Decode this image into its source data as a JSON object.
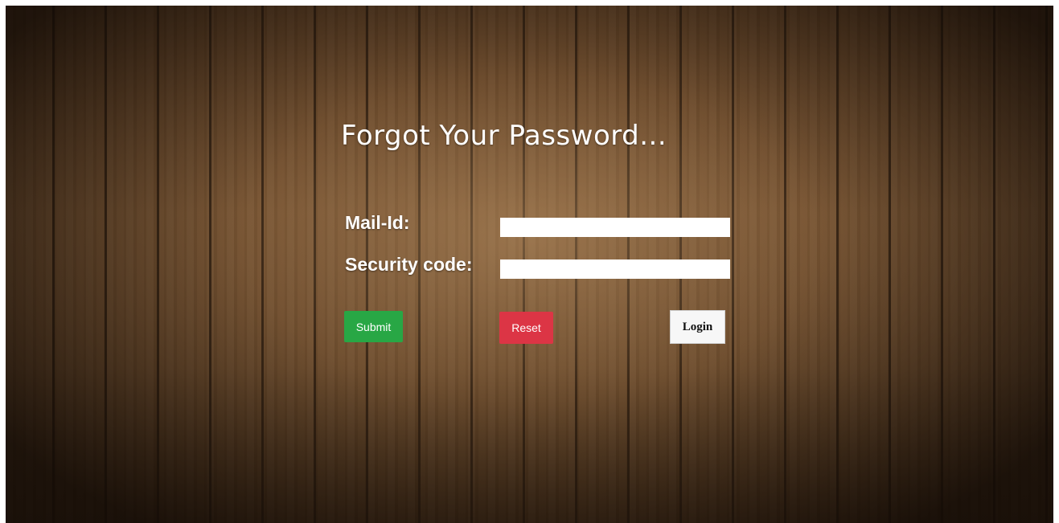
{
  "page": {
    "title": "Forgot Your Password..."
  },
  "form": {
    "mail_label": "Mail-Id:",
    "mail_value": "",
    "security_label": "Security code:",
    "security_value": ""
  },
  "buttons": {
    "submit_label": "Submit",
    "reset_label": "Reset",
    "login_label": "Login"
  },
  "colors": {
    "submit": "#28a745",
    "reset": "#dc3545",
    "login": "#f7f7f7",
    "text": "#ffffff"
  }
}
